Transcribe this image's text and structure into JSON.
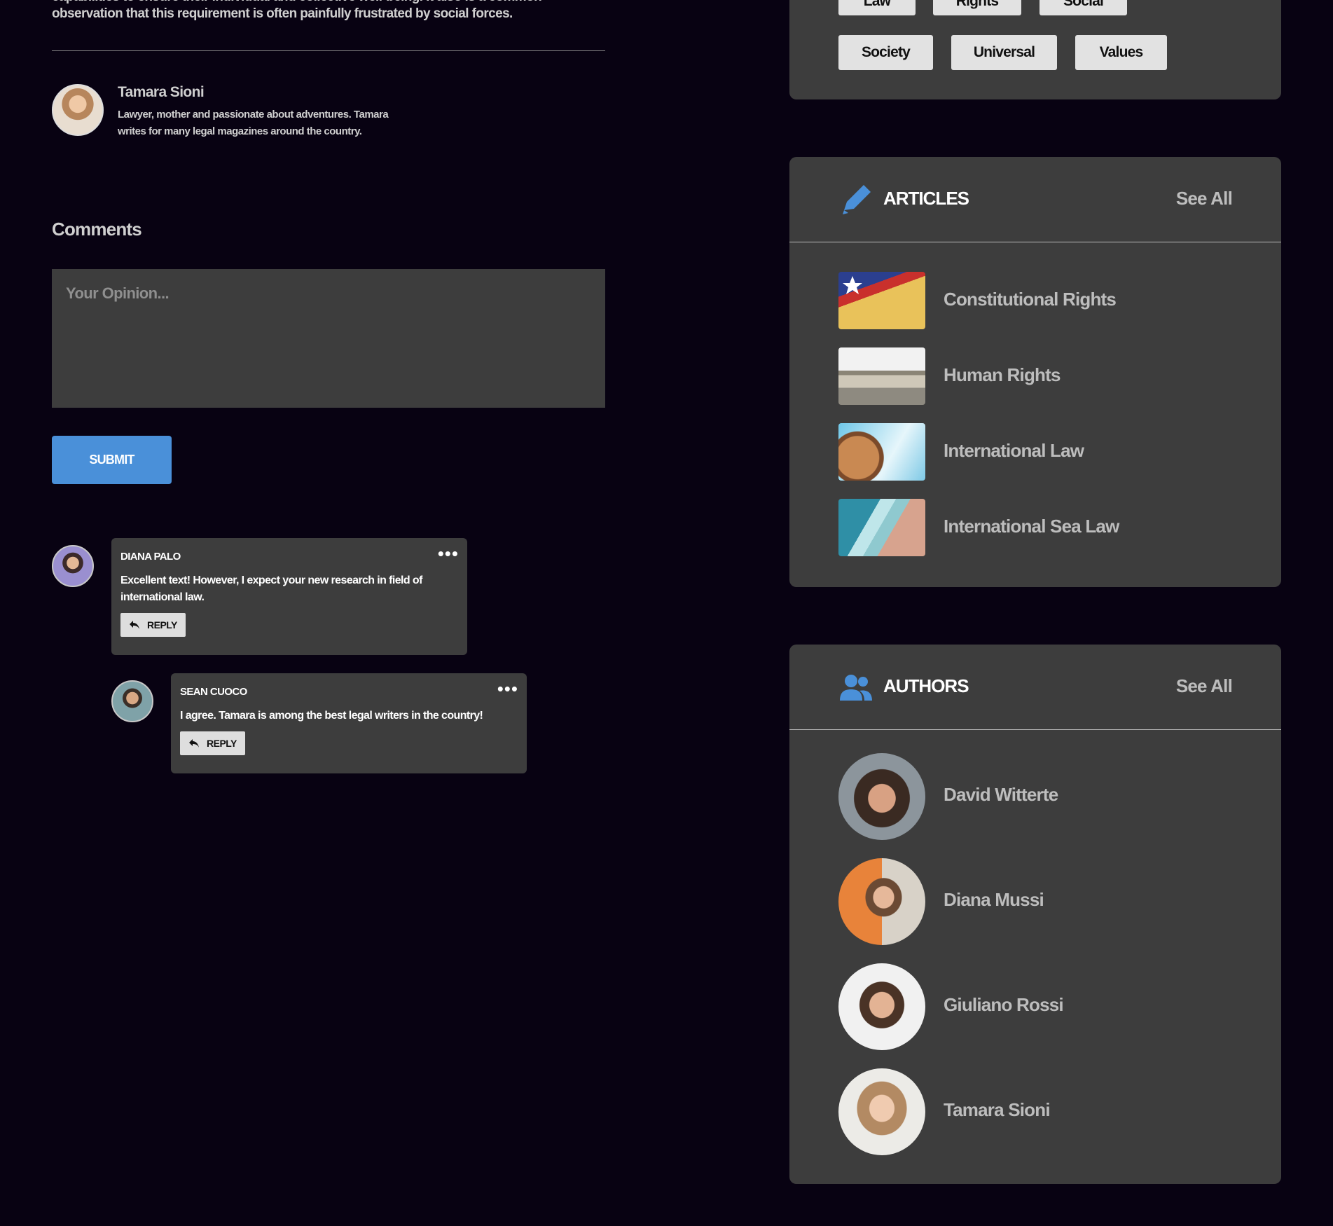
{
  "article": {
    "intro_text": "capabilities to ensure their individual and collective well-being. It also is a common observation that this requirement is often painfully frustrated by social forces."
  },
  "author": {
    "name": "Tamara Sioni",
    "bio": "Lawyer, mother and passionate about adventures. Tamara writes for many legal magazines around the country."
  },
  "comments": {
    "title": "Comments",
    "placeholder": "Your Opinion...",
    "submit_label": "SUBMIT",
    "items": [
      {
        "name": "DIANA PALO",
        "text": "Excellent text! However, I expect your new research in field of international law.",
        "reply_label": "REPLY"
      },
      {
        "name": "SEAN CUOCO",
        "text": "I agree. Tamara is among the best legal writers in the country!",
        "reply_label": "REPLY"
      }
    ],
    "more_glyph": "•••"
  },
  "tags": {
    "row1": [
      "Law",
      "Rights",
      "Social"
    ],
    "row2": [
      "Society",
      "Universal",
      "Values"
    ]
  },
  "articles": {
    "title": "ARTICLES",
    "see_all": "See All",
    "icon": "pencil-icon",
    "items": [
      "Constitutional Rights",
      "Human Rights",
      "International Law",
      "International Sea Law"
    ]
  },
  "authors": {
    "title": "AUTHORS",
    "see_all": "See All",
    "icon": "users-icon",
    "items": [
      "David Witterte",
      "Diana Mussi",
      "Giuliano Rossi",
      "Tamara Sioni"
    ]
  },
  "colors": {
    "background": "#080212",
    "card": "#3d3d3d",
    "accent": "#4a90d9",
    "tag": "#e2e2e2"
  }
}
